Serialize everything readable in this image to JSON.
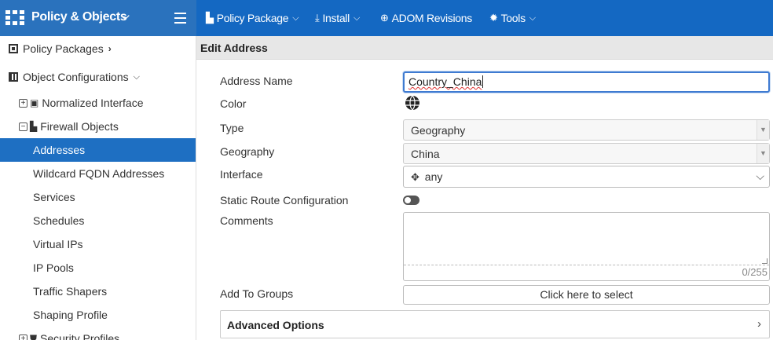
{
  "topbar": {
    "title": "Policy & Objects",
    "nav": [
      {
        "label": "Policy Package",
        "icon": "policy-package-icon"
      },
      {
        "label": "Install",
        "icon": "install-icon"
      },
      {
        "label": "ADOM Revisions",
        "icon": "globe-icon"
      },
      {
        "label": "Tools",
        "icon": "gear-icon"
      }
    ],
    "colors": {
      "bar": "#1468c2",
      "brand": "#2a72bd"
    }
  },
  "sidebar": {
    "policy_packages": "Policy Packages",
    "object_configurations": "Object Configurations",
    "items": [
      {
        "label": "Normalized Interface"
      },
      {
        "label": "Firewall Objects"
      },
      {
        "label": "Addresses"
      },
      {
        "label": "Wildcard FQDN Addresses"
      },
      {
        "label": "Services"
      },
      {
        "label": "Schedules"
      },
      {
        "label": "Virtual IPs"
      },
      {
        "label": "IP Pools"
      },
      {
        "label": "Traffic Shapers"
      },
      {
        "label": "Shaping Profile"
      },
      {
        "label": "Security Profiles"
      }
    ],
    "active_color": "#1e6fc2"
  },
  "form": {
    "title": "Edit Address",
    "labels": {
      "address_name": "Address Name",
      "color": "Color",
      "type": "Type",
      "geography": "Geography",
      "interface": "Interface",
      "static_route": "Static Route Configuration",
      "comments": "Comments",
      "add_to_groups": "Add To Groups"
    },
    "values": {
      "address_name": "Country_China",
      "type": "Geography",
      "geography": "China",
      "interface": "any",
      "comments_counter": "0/255",
      "add_to_groups": "Click here to select"
    },
    "advanced": "Advanced Options"
  }
}
